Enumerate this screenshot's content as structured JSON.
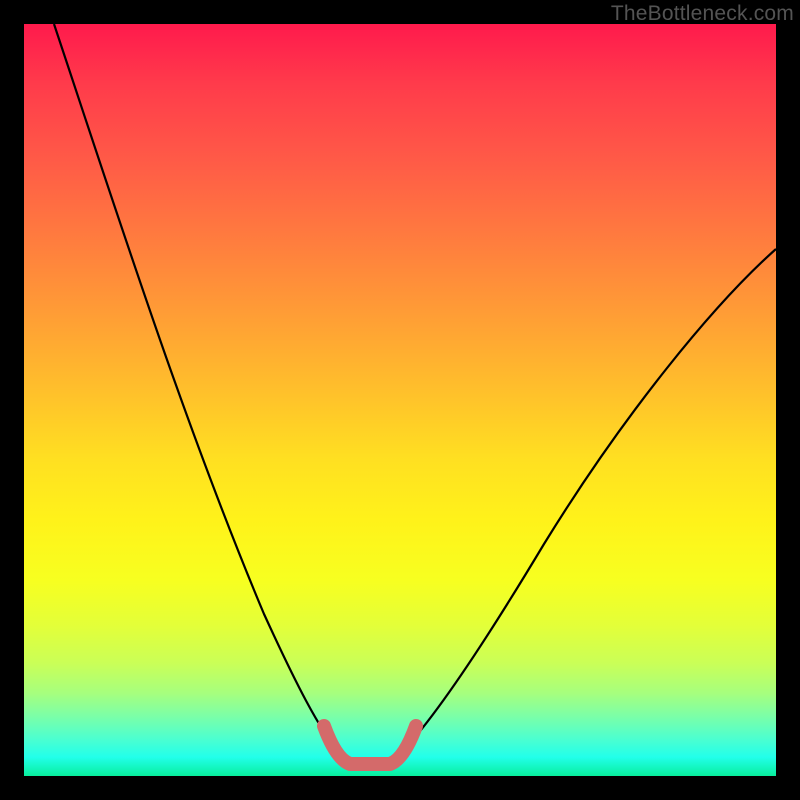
{
  "watermark": "TheBottleneck.com",
  "chart_data": {
    "type": "line",
    "title": "",
    "xlabel": "",
    "ylabel": "",
    "xlim": [
      0,
      100
    ],
    "ylim": [
      0,
      100
    ],
    "series": [
      {
        "name": "left-curve",
        "x": [
          4,
          8,
          12,
          16,
          20,
          24,
          28,
          32,
          36,
          40,
          42
        ],
        "values": [
          100,
          91,
          80,
          69,
          58,
          47,
          36,
          25,
          15,
          6,
          2
        ]
      },
      {
        "name": "right-curve",
        "x": [
          50,
          54,
          58,
          62,
          66,
          70,
          74,
          78,
          82,
          86,
          90,
          94,
          98,
          100
        ],
        "values": [
          2,
          5,
          9,
          14,
          19,
          25,
          31,
          37,
          43,
          49,
          55,
          61,
          67,
          70
        ]
      },
      {
        "name": "bottom-trough",
        "x": [
          40,
          42,
          44,
          46,
          48,
          50,
          52
        ],
        "values": [
          6,
          2,
          1,
          1,
          1,
          2,
          5
        ],
        "stroke": "#d56a6a",
        "stroke_width": 12
      }
    ],
    "background_gradient": {
      "top": "#ff1a4c",
      "mid": "#fff21a",
      "bottom": "#08ef9d"
    }
  }
}
